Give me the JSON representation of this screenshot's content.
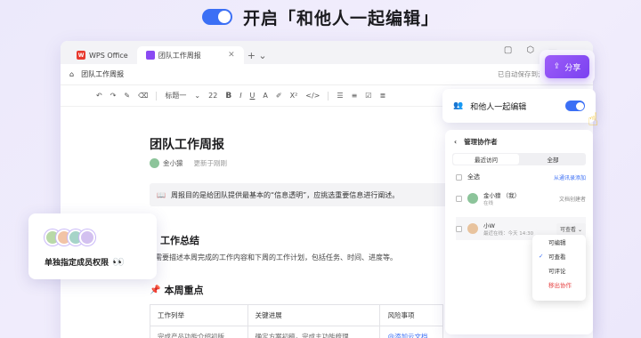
{
  "hero": {
    "title": "开启「和他人一起编辑」"
  },
  "window": {
    "tabs": [
      {
        "label": "WPS Office",
        "icon": "wps-logo-icon"
      },
      {
        "label": "团队工作周报",
        "icon": "document-icon"
      }
    ],
    "doc_name": "团队工作周报",
    "saved_status": "已自动保存到云端",
    "toolbar": {
      "heading_style": "标题一",
      "font_size": "22",
      "bold": "B",
      "italic": "I",
      "underline": "U",
      "font_color": "A",
      "superscript": "X²",
      "code": "</>"
    }
  },
  "document": {
    "title": "团队工作周报",
    "author": "金小獴",
    "updated": "更新于刚刚",
    "callout": "周报目的是给团队提供最基本的“信息透明”，应挑选重要信息进行阐述。",
    "section1_title": "工作总结",
    "section1_body": "需要描述本周完成的工作内容和下周的工作计划，包括任务、时间、进度等。",
    "section2_title": "本周重点",
    "table": {
      "headers": [
        "工作列举",
        "关键进展",
        "风险事项"
      ],
      "row": [
        "完成产品功能介绍初版",
        "确定方案初稿，完成主功能梳理",
        "@添加云文档"
      ]
    }
  },
  "share": {
    "label": "分享"
  },
  "collab": {
    "label": "和他人一起编辑",
    "enabled": true
  },
  "manage": {
    "title": "管理协作者",
    "tabs": [
      "最近访问",
      "全部"
    ],
    "select_all": "全选",
    "add_from_contacts": "从通讯录添加",
    "members": [
      {
        "name": "金小獴 （我）",
        "status": "在线",
        "role": "文档创建者"
      },
      {
        "name": "小W",
        "status": "最近在线：今天 14:30",
        "role": "可查看"
      }
    ],
    "dropdown": [
      "可编辑",
      "可查看",
      "可评论",
      "移出协作"
    ],
    "dropdown_selected": "可查看"
  },
  "assign": {
    "label": "单独指定成员权限",
    "emoji": "👀"
  },
  "colors": {
    "accent": "#3b6ff5",
    "share_purple": "#8a4af3",
    "danger": "#e53e3e"
  }
}
